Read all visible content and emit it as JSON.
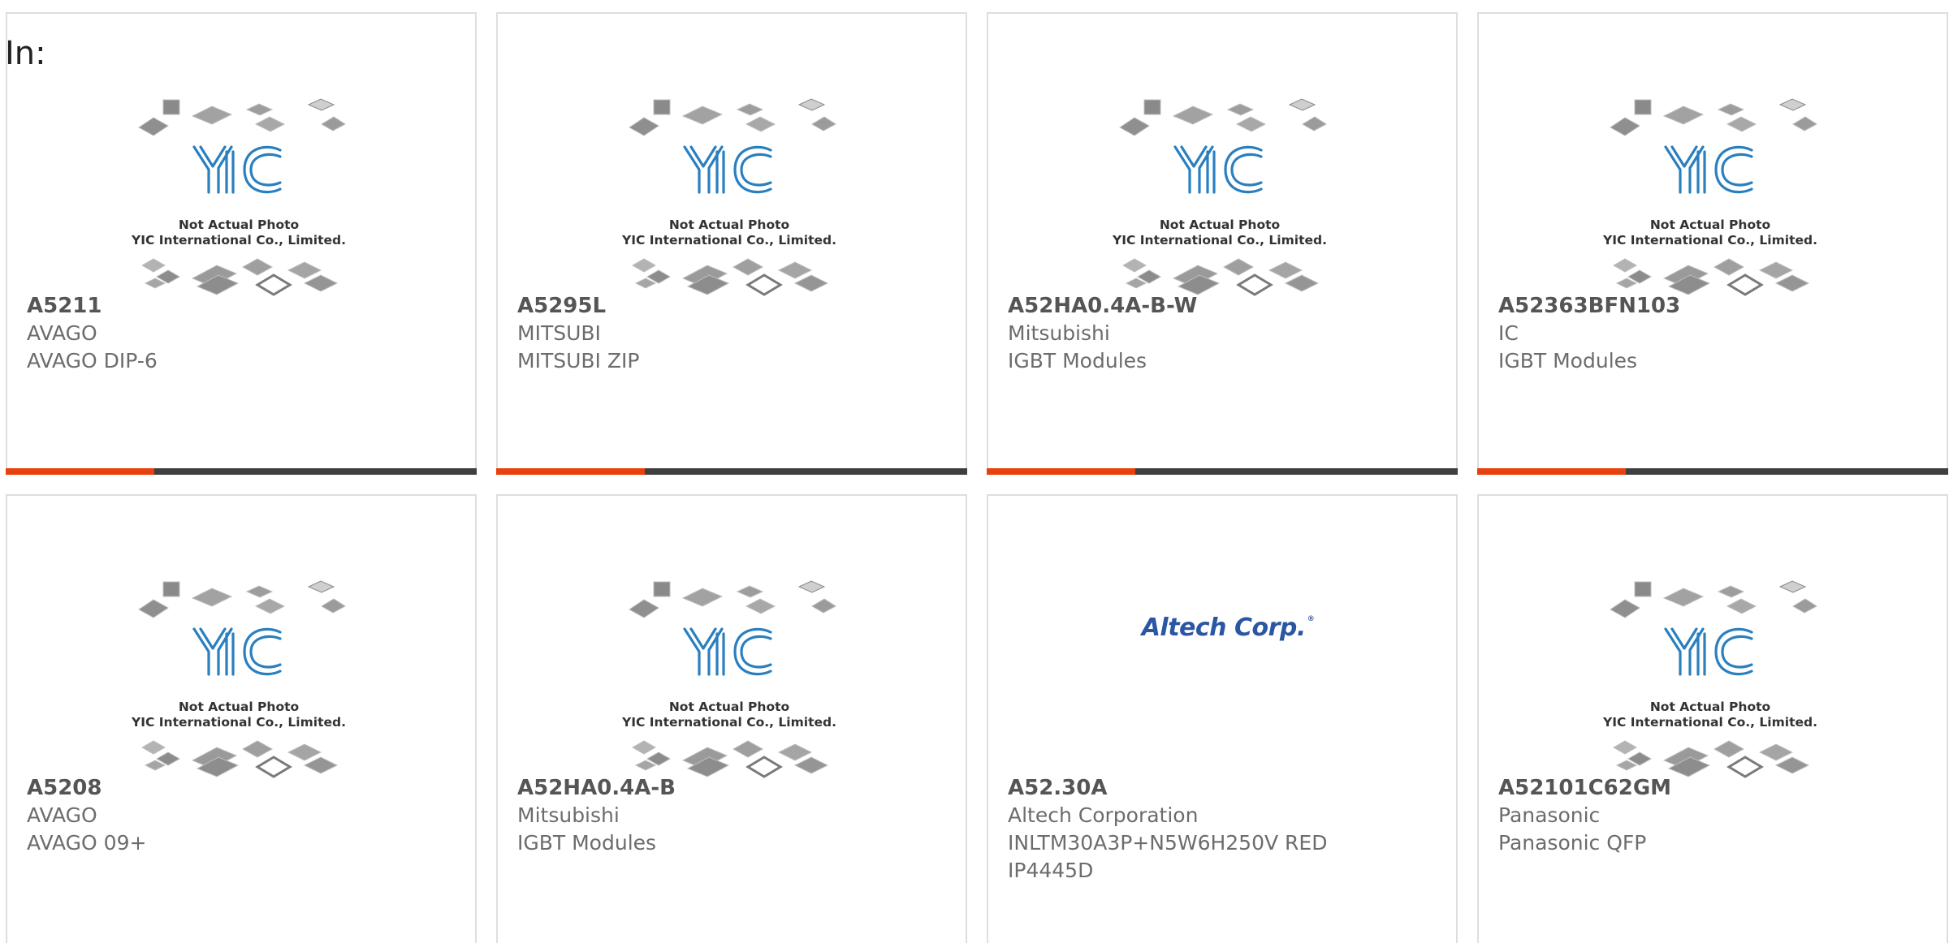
{
  "header": {
    "label": "In:"
  },
  "placeholder_image": {
    "line1": "Not Actual Photo",
    "line2": "YIC International Co., Limited."
  },
  "colors": {
    "accent": "#e8410e",
    "bar": "#3f3f3f",
    "logo_blue": "#2a56a4"
  },
  "products": [
    {
      "part": "A5211",
      "maker": "AVAGO",
      "desc": "AVAGO DIP-6",
      "image": "yic-placeholder"
    },
    {
      "part": "A5295L",
      "maker": "MITSUBI",
      "desc": "MITSUBI ZIP",
      "image": "yic-placeholder"
    },
    {
      "part": "A52HA0.4A-B-W",
      "maker": "Mitsubishi",
      "desc": "IGBT Modules",
      "image": "yic-placeholder"
    },
    {
      "part": "A52363BFN103",
      "maker": "IC",
      "desc": "IGBT Modules",
      "image": "yic-placeholder"
    },
    {
      "part": "A5208",
      "maker": "AVAGO",
      "desc": "AVAGO 09+",
      "image": "yic-placeholder"
    },
    {
      "part": "A52HA0.4A-B",
      "maker": "Mitsubishi",
      "desc": "IGBT Modules",
      "image": "yic-placeholder"
    },
    {
      "part": "A52.30A",
      "maker": "Altech Corporation",
      "desc": "INLTM30A3P+N5W6H250V RED",
      "desc2": "IP4445D",
      "image": "altech-logo",
      "logo_text": "Altech Corp."
    },
    {
      "part": "A52101C62GM",
      "maker": "Panasonic",
      "desc": "Panasonic QFP",
      "image": "yic-placeholder"
    }
  ]
}
